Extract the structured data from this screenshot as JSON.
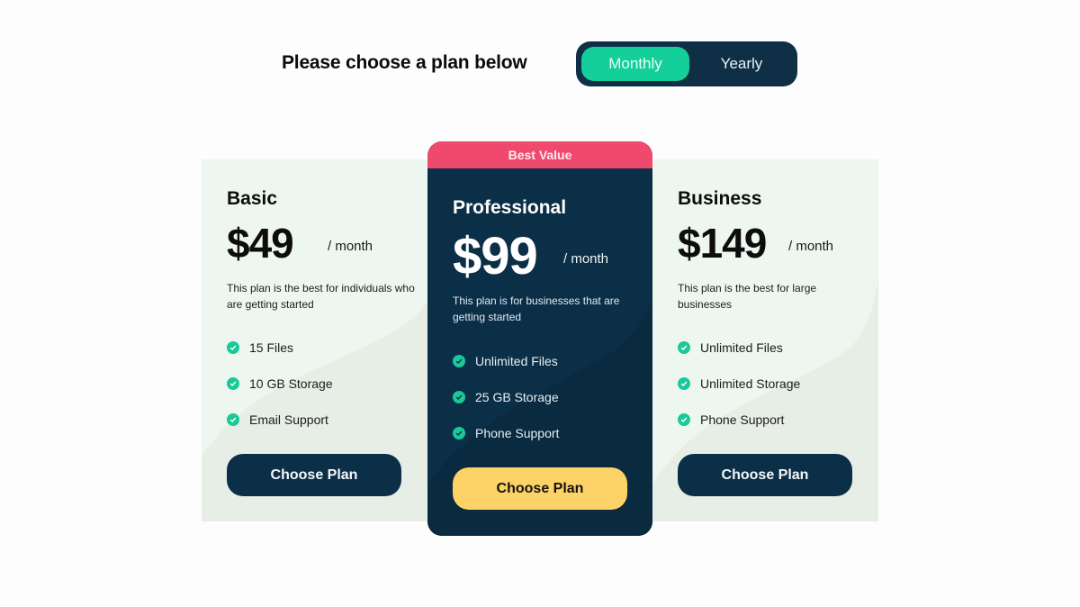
{
  "header": {
    "title": "Please choose a plan below",
    "billing_toggle": {
      "options": [
        "Monthly",
        "Yearly"
      ],
      "selected": "Monthly"
    }
  },
  "colors": {
    "navy": "#0c2f48",
    "accent_green": "#15cf9a",
    "badge_pink": "#ef4a6e",
    "cta_yellow": "#fdd266",
    "band_light": "#eef7ef"
  },
  "plans": [
    {
      "name": "Basic",
      "price": "$49",
      "period": "/ month",
      "description": "This plan is the best for individuals who are getting started",
      "features": [
        "15 Files",
        "10 GB Storage",
        "Email Support"
      ],
      "cta": "Choose Plan"
    },
    {
      "name": "Professional",
      "badge": "Best Value",
      "price": "$99",
      "period": "/ month",
      "description": "This plan is for businesses that are getting started",
      "features": [
        "Unlimited Files",
        "25 GB Storage",
        "Phone Support"
      ],
      "cta": "Choose Plan",
      "highlighted": true
    },
    {
      "name": "Business",
      "price": "$149",
      "period": "/ month",
      "description": "This plan is the best for large businesses",
      "features": [
        "Unlimited Files",
        "Unlimited Storage",
        "Phone Support"
      ],
      "cta": "Choose Plan"
    }
  ]
}
